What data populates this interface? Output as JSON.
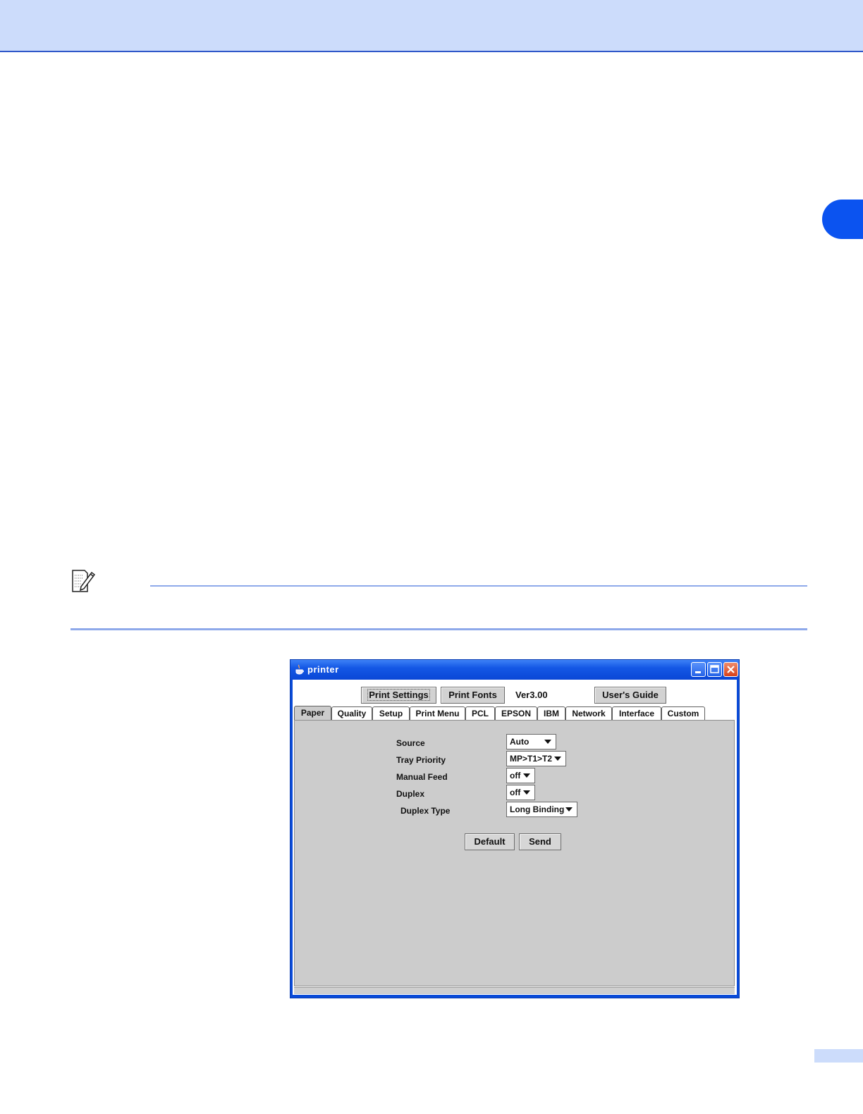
{
  "window": {
    "title": "printer",
    "icon": "java-cup-icon"
  },
  "toolbar": {
    "print_settings_label": "Print Settings",
    "print_fonts_label": "Print Fonts",
    "version": "Ver3.00",
    "users_guide_label": "User's Guide"
  },
  "tabs": [
    {
      "label": "Paper",
      "active": true
    },
    {
      "label": "Quality"
    },
    {
      "label": "Setup"
    },
    {
      "label": "Print Menu"
    },
    {
      "label": "PCL"
    },
    {
      "label": "EPSON"
    },
    {
      "label": "IBM"
    },
    {
      "label": "Network"
    },
    {
      "label": "Interface"
    },
    {
      "label": "Custom"
    }
  ],
  "paper": {
    "source": {
      "label": "Source",
      "value": "Auto"
    },
    "tray_priority": {
      "label": "Tray Priority",
      "value": "MP>T1>T2"
    },
    "manual_feed": {
      "label": "Manual Feed",
      "value": "off"
    },
    "duplex": {
      "label": "Duplex",
      "value": "off"
    },
    "duplex_type": {
      "label": "Duplex Type",
      "value": "Long Binding"
    }
  },
  "actions": {
    "default_label": "Default",
    "send_label": "Send"
  },
  "colors": {
    "header_band": "#ccdcfb",
    "accent_blue": "#0b53f0",
    "title_bar": "#1457e5",
    "panel_gray": "#cccccc"
  },
  "icons": {
    "note": "note-pencil-icon"
  }
}
